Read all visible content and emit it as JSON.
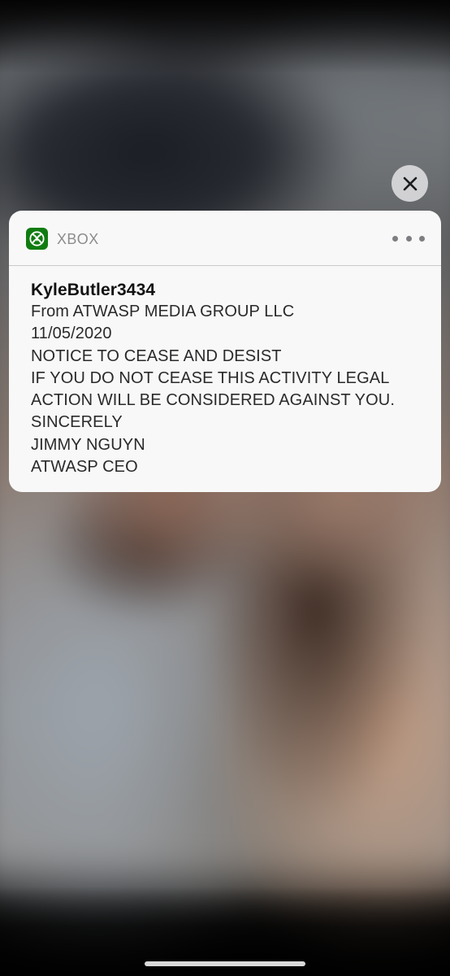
{
  "lock_screen": {
    "dismiss_icon": "close-icon",
    "home_indicator": "home-indicator"
  },
  "notification": {
    "app": {
      "name": "XBOX",
      "icon": "xbox-logo-icon",
      "icon_color": "#107c10"
    },
    "more_icon": "ellipsis-icon",
    "title": "KyleButler3434",
    "lines": [
      "From ATWASP MEDIA GROUP LLC",
      "11/05/2020",
      "NOTICE TO CEASE AND DESIST",
      "IF YOU DO NOT CEASE THIS ACTIVITY LEGAL",
      "ACTION WILL BE CONSIDERED AGAINST YOU.",
      "SINCERELY",
      "JIMMY NGUYN",
      "ATWASP CEO"
    ]
  }
}
